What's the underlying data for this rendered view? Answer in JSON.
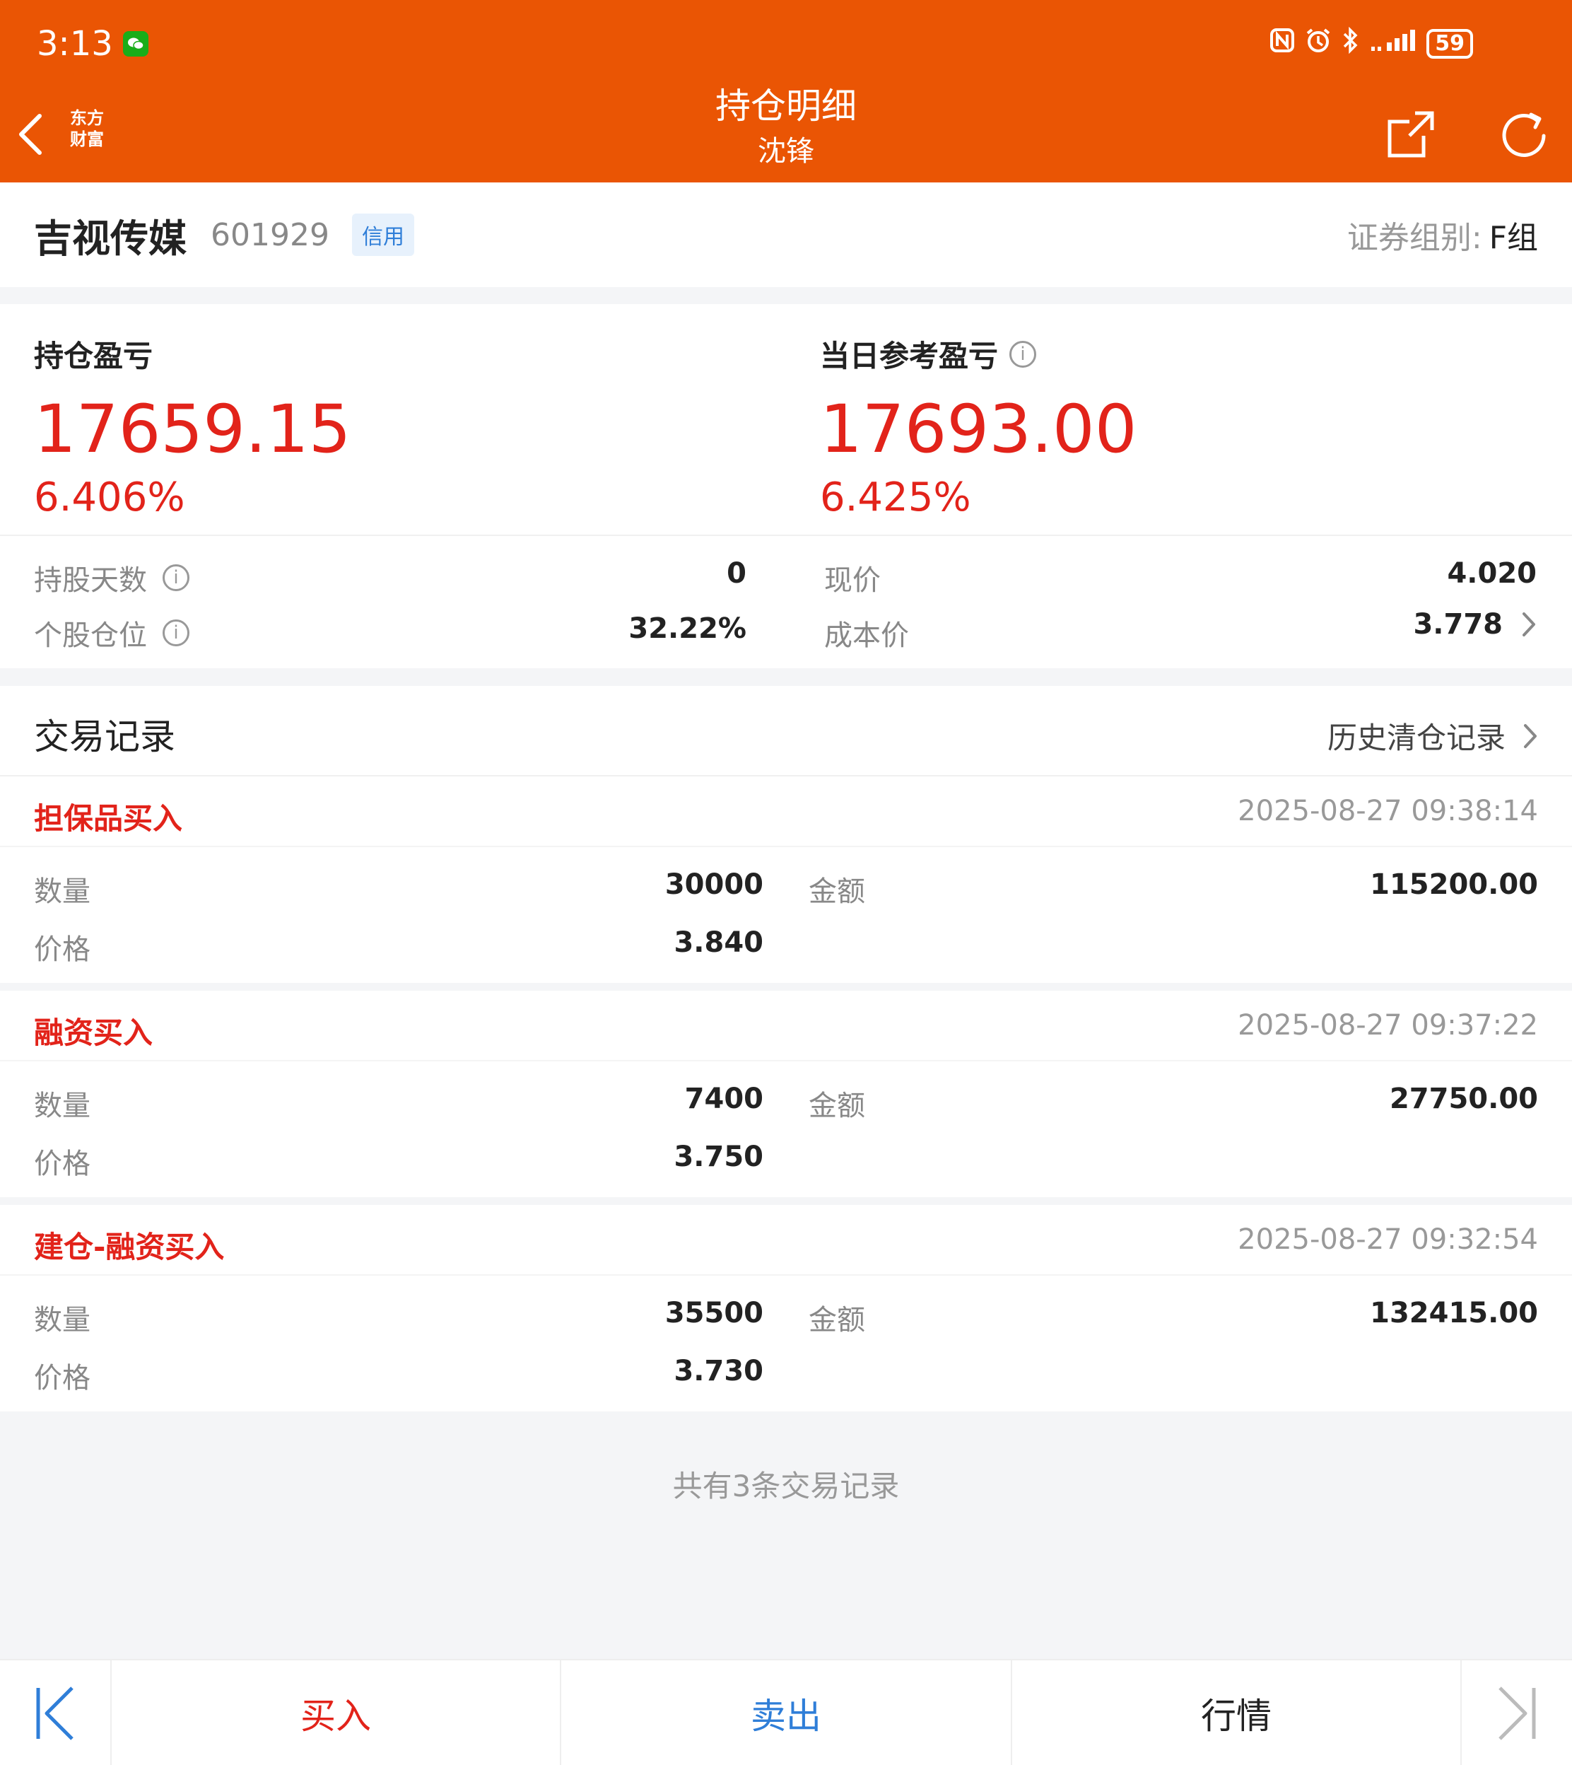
{
  "status_bar": {
    "time": "3:13",
    "battery": "59"
  },
  "header": {
    "title": "持仓明细",
    "subtitle": "沈锋",
    "logo_line1": "东方",
    "logo_line2": "财富"
  },
  "stock": {
    "name": "吉视传媒",
    "code": "601929",
    "tag": "信用",
    "group_label": "证券组别:",
    "group_value": "F组"
  },
  "profit": {
    "holding_label": "持仓盈亏",
    "holding_value": "17659.15",
    "holding_pct": "6.406%",
    "daily_label": "当日参考盈亏",
    "daily_value": "17693.00",
    "daily_pct": "6.425%"
  },
  "details": {
    "days_label": "持股天数",
    "days_value": "0",
    "position_label": "个股仓位",
    "position_value": "32.22%",
    "price_label": "现价",
    "price_value": "4.020",
    "cost_label": "成本价",
    "cost_value": "3.778"
  },
  "trades": {
    "title": "交易记录",
    "history_label": "历史清仓记录",
    "qty_label": "数量",
    "price_label": "价格",
    "amount_label": "金额",
    "records": [
      {
        "type": "担保品买入",
        "time": "2025-08-27 09:38:14",
        "qty": "30000",
        "price": "3.840",
        "amount": "115200.00"
      },
      {
        "type": "融资买入",
        "time": "2025-08-27 09:37:22",
        "qty": "7400",
        "price": "3.750",
        "amount": "27750.00"
      },
      {
        "type": "建仓-融资买入",
        "time": "2025-08-27 09:32:54",
        "qty": "35500",
        "price": "3.730",
        "amount": "132415.00"
      }
    ],
    "summary": "共有3条交易记录"
  },
  "bottom_bar": {
    "buy": "买入",
    "sell": "卖出",
    "market": "行情"
  },
  "colors": {
    "header_bg": "#ea5504",
    "profit_red": "#e2231a",
    "sell_blue": "#2f7ed8",
    "credit_tag_bg": "#e7f1fc"
  }
}
